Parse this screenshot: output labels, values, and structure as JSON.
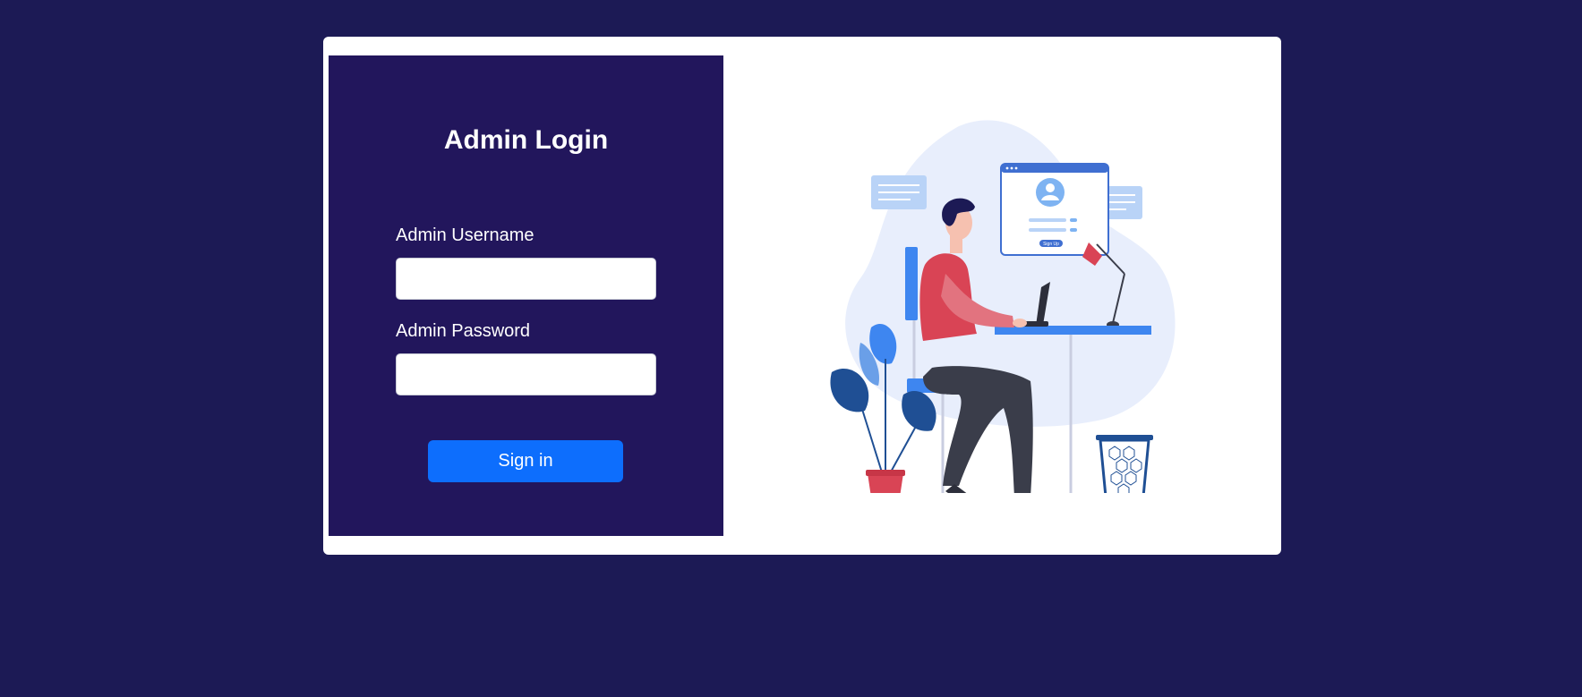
{
  "login": {
    "title": "Admin Login",
    "username_label": "Admin Username",
    "username_value": "",
    "password_label": "Admin Password",
    "password_value": "",
    "submit_label": "Sign in"
  },
  "illustration": {
    "screen_button_label": "Sign Up"
  },
  "colors": {
    "page_background": "#1c1a55",
    "login_panel": "#22165c",
    "primary_button": "#0d6efd",
    "card": "#ffffff"
  }
}
